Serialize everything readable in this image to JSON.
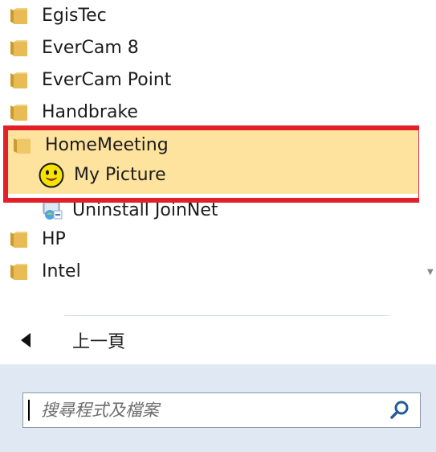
{
  "program_list": {
    "items": [
      {
        "label": "EgisTec",
        "icon": "folder-icon"
      },
      {
        "label": "EverCam 8",
        "icon": "folder-icon"
      },
      {
        "label": "EverCam Point",
        "icon": "folder-icon"
      },
      {
        "label": "Handbrake",
        "icon": "folder-icon"
      },
      {
        "label": "HomeMeeting",
        "icon": "folder-icon"
      },
      {
        "label": "My Picture",
        "icon": "smiley-icon"
      },
      {
        "label": "Uninstall JoinNet",
        "icon": "uninstall-icon"
      },
      {
        "label": "HP",
        "icon": "folder-icon"
      },
      {
        "label": "Intel",
        "icon": "folder-icon"
      }
    ]
  },
  "back": {
    "label": "上一頁",
    "icon": "back-arrow-icon"
  },
  "search": {
    "placeholder": "搜尋程式及檔案",
    "icon": "search-icon"
  },
  "colors": {
    "highlight_border": "#e3202a",
    "selected_background": "#fde39d",
    "search_panel": "#dfe8f3",
    "folder": "#e3b553"
  }
}
